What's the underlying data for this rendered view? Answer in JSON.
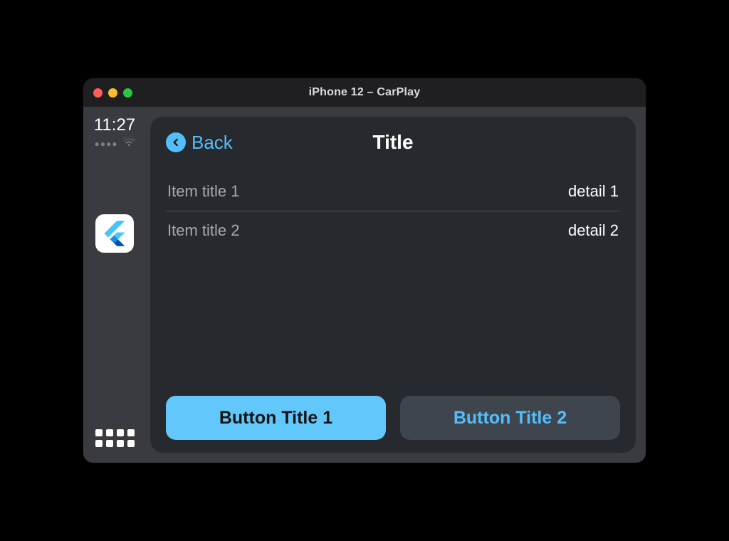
{
  "window": {
    "title": "iPhone 12 – CarPlay"
  },
  "sidebar": {
    "clock": "11:27"
  },
  "nav": {
    "back_label": "Back",
    "title": "Title"
  },
  "list": {
    "items": [
      {
        "title": "Item title 1",
        "detail": "detail 1"
      },
      {
        "title": "Item title 2",
        "detail": "detail 2"
      }
    ]
  },
  "buttons": {
    "primary_label": "Button Title 1",
    "secondary_label": "Button Title 2"
  },
  "colors": {
    "accent": "#55befa",
    "primary_button_bg": "#62c8fb",
    "secondary_button_bg": "#3f454c",
    "content_bg": "#262a2f",
    "window_bg": "#3a3b40"
  }
}
